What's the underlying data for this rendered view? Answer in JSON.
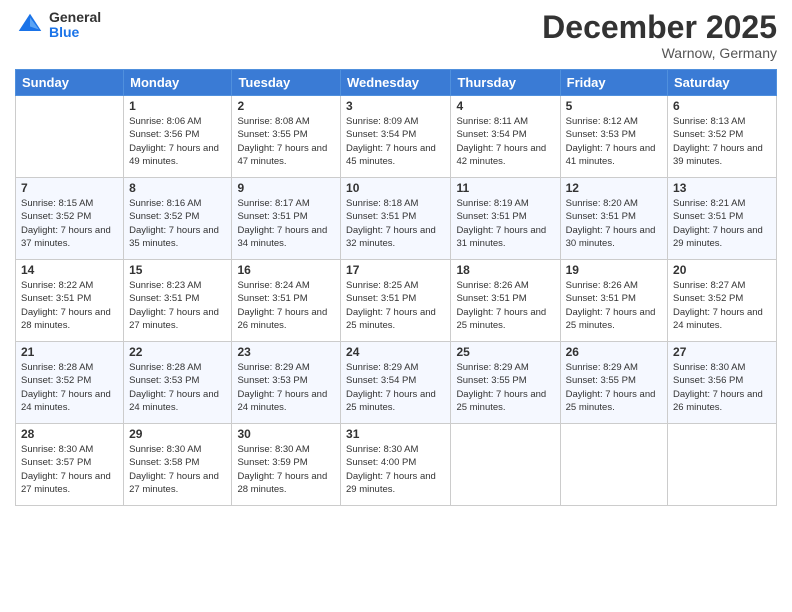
{
  "header": {
    "logo": {
      "general": "General",
      "blue": "Blue"
    },
    "title": "December 2025",
    "location": "Warnow, Germany"
  },
  "days_of_week": [
    "Sunday",
    "Monday",
    "Tuesday",
    "Wednesday",
    "Thursday",
    "Friday",
    "Saturday"
  ],
  "weeks": [
    [
      {
        "day": "",
        "sunrise": "",
        "sunset": "",
        "daylight": ""
      },
      {
        "day": "1",
        "sunrise": "Sunrise: 8:06 AM",
        "sunset": "Sunset: 3:56 PM",
        "daylight": "Daylight: 7 hours and 49 minutes."
      },
      {
        "day": "2",
        "sunrise": "Sunrise: 8:08 AM",
        "sunset": "Sunset: 3:55 PM",
        "daylight": "Daylight: 7 hours and 47 minutes."
      },
      {
        "day": "3",
        "sunrise": "Sunrise: 8:09 AM",
        "sunset": "Sunset: 3:54 PM",
        "daylight": "Daylight: 7 hours and 45 minutes."
      },
      {
        "day": "4",
        "sunrise": "Sunrise: 8:11 AM",
        "sunset": "Sunset: 3:54 PM",
        "daylight": "Daylight: 7 hours and 42 minutes."
      },
      {
        "day": "5",
        "sunrise": "Sunrise: 8:12 AM",
        "sunset": "Sunset: 3:53 PM",
        "daylight": "Daylight: 7 hours and 41 minutes."
      },
      {
        "day": "6",
        "sunrise": "Sunrise: 8:13 AM",
        "sunset": "Sunset: 3:52 PM",
        "daylight": "Daylight: 7 hours and 39 minutes."
      }
    ],
    [
      {
        "day": "7",
        "sunrise": "Sunrise: 8:15 AM",
        "sunset": "Sunset: 3:52 PM",
        "daylight": "Daylight: 7 hours and 37 minutes."
      },
      {
        "day": "8",
        "sunrise": "Sunrise: 8:16 AM",
        "sunset": "Sunset: 3:52 PM",
        "daylight": "Daylight: 7 hours and 35 minutes."
      },
      {
        "day": "9",
        "sunrise": "Sunrise: 8:17 AM",
        "sunset": "Sunset: 3:51 PM",
        "daylight": "Daylight: 7 hours and 34 minutes."
      },
      {
        "day": "10",
        "sunrise": "Sunrise: 8:18 AM",
        "sunset": "Sunset: 3:51 PM",
        "daylight": "Daylight: 7 hours and 32 minutes."
      },
      {
        "day": "11",
        "sunrise": "Sunrise: 8:19 AM",
        "sunset": "Sunset: 3:51 PM",
        "daylight": "Daylight: 7 hours and 31 minutes."
      },
      {
        "day": "12",
        "sunrise": "Sunrise: 8:20 AM",
        "sunset": "Sunset: 3:51 PM",
        "daylight": "Daylight: 7 hours and 30 minutes."
      },
      {
        "day": "13",
        "sunrise": "Sunrise: 8:21 AM",
        "sunset": "Sunset: 3:51 PM",
        "daylight": "Daylight: 7 hours and 29 minutes."
      }
    ],
    [
      {
        "day": "14",
        "sunrise": "Sunrise: 8:22 AM",
        "sunset": "Sunset: 3:51 PM",
        "daylight": "Daylight: 7 hours and 28 minutes."
      },
      {
        "day": "15",
        "sunrise": "Sunrise: 8:23 AM",
        "sunset": "Sunset: 3:51 PM",
        "daylight": "Daylight: 7 hours and 27 minutes."
      },
      {
        "day": "16",
        "sunrise": "Sunrise: 8:24 AM",
        "sunset": "Sunset: 3:51 PM",
        "daylight": "Daylight: 7 hours and 26 minutes."
      },
      {
        "day": "17",
        "sunrise": "Sunrise: 8:25 AM",
        "sunset": "Sunset: 3:51 PM",
        "daylight": "Daylight: 7 hours and 25 minutes."
      },
      {
        "day": "18",
        "sunrise": "Sunrise: 8:26 AM",
        "sunset": "Sunset: 3:51 PM",
        "daylight": "Daylight: 7 hours and 25 minutes."
      },
      {
        "day": "19",
        "sunrise": "Sunrise: 8:26 AM",
        "sunset": "Sunset: 3:51 PM",
        "daylight": "Daylight: 7 hours and 25 minutes."
      },
      {
        "day": "20",
        "sunrise": "Sunrise: 8:27 AM",
        "sunset": "Sunset: 3:52 PM",
        "daylight": "Daylight: 7 hours and 24 minutes."
      }
    ],
    [
      {
        "day": "21",
        "sunrise": "Sunrise: 8:28 AM",
        "sunset": "Sunset: 3:52 PM",
        "daylight": "Daylight: 7 hours and 24 minutes."
      },
      {
        "day": "22",
        "sunrise": "Sunrise: 8:28 AM",
        "sunset": "Sunset: 3:53 PM",
        "daylight": "Daylight: 7 hours and 24 minutes."
      },
      {
        "day": "23",
        "sunrise": "Sunrise: 8:29 AM",
        "sunset": "Sunset: 3:53 PM",
        "daylight": "Daylight: 7 hours and 24 minutes."
      },
      {
        "day": "24",
        "sunrise": "Sunrise: 8:29 AM",
        "sunset": "Sunset: 3:54 PM",
        "daylight": "Daylight: 7 hours and 25 minutes."
      },
      {
        "day": "25",
        "sunrise": "Sunrise: 8:29 AM",
        "sunset": "Sunset: 3:55 PM",
        "daylight": "Daylight: 7 hours and 25 minutes."
      },
      {
        "day": "26",
        "sunrise": "Sunrise: 8:29 AM",
        "sunset": "Sunset: 3:55 PM",
        "daylight": "Daylight: 7 hours and 25 minutes."
      },
      {
        "day": "27",
        "sunrise": "Sunrise: 8:30 AM",
        "sunset": "Sunset: 3:56 PM",
        "daylight": "Daylight: 7 hours and 26 minutes."
      }
    ],
    [
      {
        "day": "28",
        "sunrise": "Sunrise: 8:30 AM",
        "sunset": "Sunset: 3:57 PM",
        "daylight": "Daylight: 7 hours and 27 minutes."
      },
      {
        "day": "29",
        "sunrise": "Sunrise: 8:30 AM",
        "sunset": "Sunset: 3:58 PM",
        "daylight": "Daylight: 7 hours and 27 minutes."
      },
      {
        "day": "30",
        "sunrise": "Sunrise: 8:30 AM",
        "sunset": "Sunset: 3:59 PM",
        "daylight": "Daylight: 7 hours and 28 minutes."
      },
      {
        "day": "31",
        "sunrise": "Sunrise: 8:30 AM",
        "sunset": "Sunset: 4:00 PM",
        "daylight": "Daylight: 7 hours and 29 minutes."
      },
      {
        "day": "",
        "sunrise": "",
        "sunset": "",
        "daylight": ""
      },
      {
        "day": "",
        "sunrise": "",
        "sunset": "",
        "daylight": ""
      },
      {
        "day": "",
        "sunrise": "",
        "sunset": "",
        "daylight": ""
      }
    ]
  ]
}
